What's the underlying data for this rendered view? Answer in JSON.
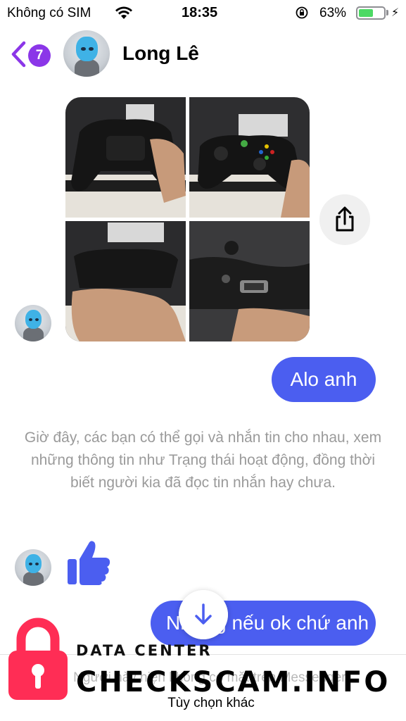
{
  "status_bar": {
    "carrier": "Không có SIM",
    "time": "18:35",
    "battery_percent": "63%",
    "battery_level": 0.63
  },
  "header": {
    "unread_count": "7",
    "contact_name": "Long Lê",
    "accent_color": "#8b36e8"
  },
  "messages": {
    "outgoing_1": "Alo anh",
    "system_note": "Giờ đây, các bạn có thể gọi và nhắn tin cho nhau, xem những thông tin như Trạng thái hoạt động, đồng thời biết người kia đã đọc tin nhắn hay chưa.",
    "outgoing_2": "Nhưng nếu ok chứ anh",
    "bubble_color": "#4b5ef0"
  },
  "footer": {
    "notice": "Người này hiện không có mặt trên Messenger.",
    "more_options": "Tùy chọn khác"
  },
  "watermark": {
    "subtitle": "DATA CENTER",
    "title": "CHECKSCAM.INFO",
    "color": "#ff2d55"
  },
  "icons": [
    "wifi-icon",
    "rotation-lock-icon",
    "battery-icon",
    "charging-icon",
    "back-chevron-icon",
    "share-icon",
    "thumbs-up-icon",
    "arrow-down-icon",
    "padlock-icon"
  ]
}
